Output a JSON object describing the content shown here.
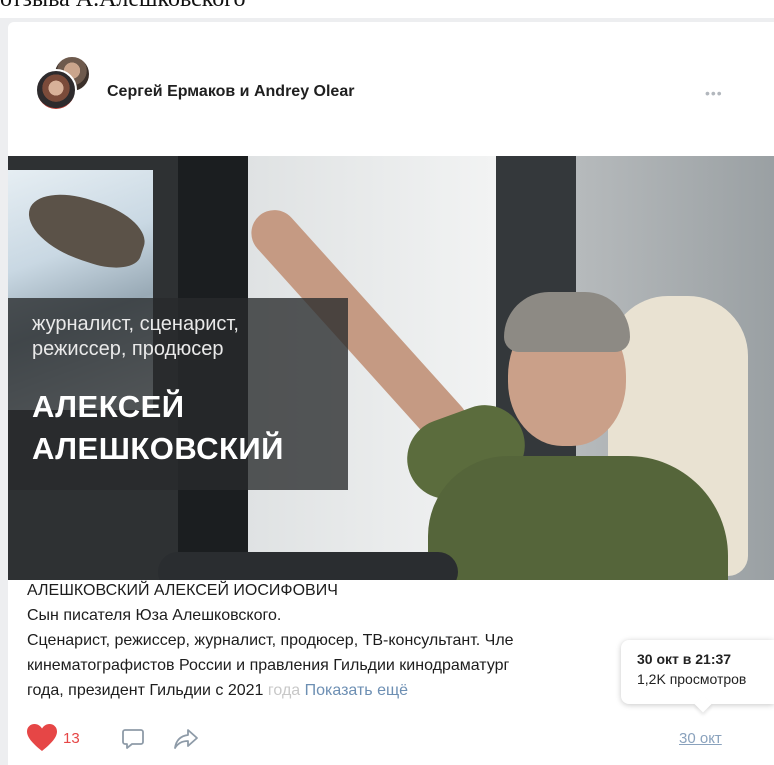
{
  "top_text": "отзыва А.Алешковского",
  "post": {
    "author": "Сергей Ермаков и Andrey Olear",
    "more_icon": "ellipsis-icon",
    "image_caption": {
      "role_line1": "журналист, сценарист,",
      "role_line2": "режиссер, продюсер",
      "name_line1": "АЛЕКСЕЙ",
      "name_line2": "АЛЕШКОВСКИЙ"
    },
    "text": {
      "line1": "АЛЕШКОВСКИЙ АЛЕКСЕЙ ИОСИФОВИЧ",
      "line2": "Сын писателя Юза Алешковского.",
      "line3": "Сценарист, режиссер, журналист, продюсер, ТВ-консультант. Чле",
      "line4": "кинематографистов России и правления Гильдии кинодраматург",
      "line5_main": "года, президент Гильдии с 2021 ",
      "line5_fade": "года",
      "show_more": " Показать ещё"
    },
    "footer": {
      "likes": "13",
      "like_icon": "heart-icon",
      "comment_icon": "comment-icon",
      "share_icon": "share-icon",
      "date": "30 окт",
      "like_color": "#e64646"
    },
    "tooltip": {
      "date_time": "30 окт в 21:37",
      "views": "1,2K просмотров"
    }
  }
}
